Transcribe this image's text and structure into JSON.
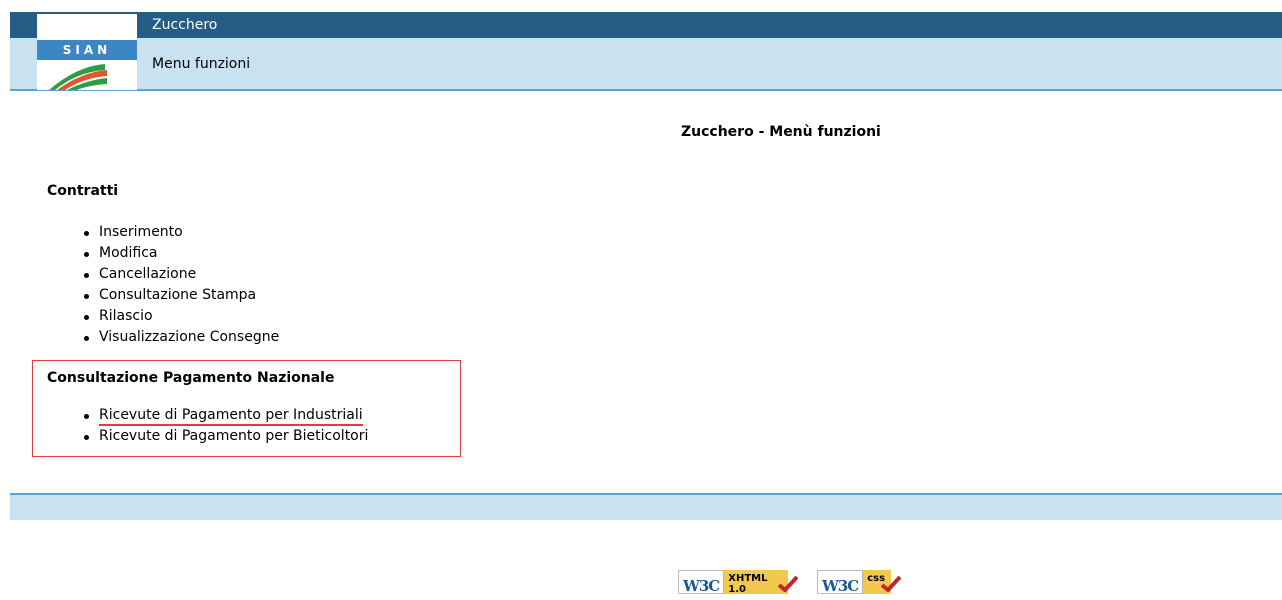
{
  "header": {
    "logo_text": "SIAN",
    "app_title": "Zucchero",
    "subtitle": "Menu funzioni"
  },
  "page": {
    "title": "Zucchero - Menù funzioni"
  },
  "sections": [
    {
      "title": "Contratti",
      "items": [
        "Inserimento",
        "Modifica",
        "Cancellazione",
        "Consultazione Stampa",
        "Rilascio",
        "Visualizzazione Consegne"
      ]
    },
    {
      "title": "Consultazione Pagamento Nazionale",
      "items": [
        "Ricevute di Pagamento per Industriali",
        "Ricevute di Pagamento per Bieticoltori"
      ]
    }
  ],
  "footer": {
    "badges": [
      {
        "w3c": "W3C",
        "label": "XHTML 1.0",
        "icon": "check-icon"
      },
      {
        "w3c": "W3C",
        "label": "css",
        "icon": "check-icon"
      }
    ]
  },
  "colors": {
    "header_dark": "#255d86",
    "header_light": "#c9e2f0",
    "accent_line": "#5ea3d2",
    "highlight_border": "#e23c3c"
  }
}
